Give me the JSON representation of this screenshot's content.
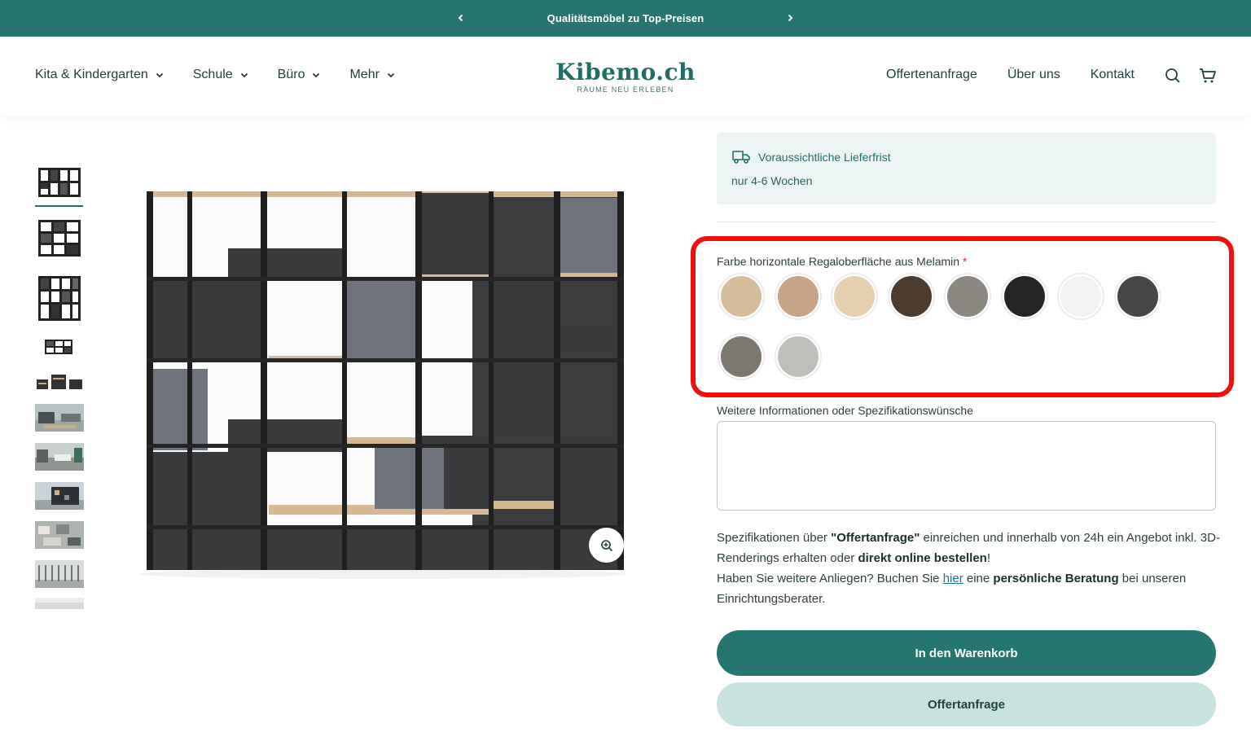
{
  "announcement": {
    "text": "Qualitätsmöbel zu Top-Preisen",
    "prev_icon": "chevron-left-icon",
    "next_icon": "chevron-right-icon"
  },
  "nav": {
    "left": [
      {
        "label": "Kita & Kindergarten"
      },
      {
        "label": "Schule"
      },
      {
        "label": "Büro"
      },
      {
        "label": "Mehr"
      }
    ],
    "right": [
      {
        "label": "Offertenanfrage"
      },
      {
        "label": "Über uns"
      },
      {
        "label": "Kontakt"
      }
    ]
  },
  "logo": {
    "word": "Kibemo.ch",
    "tagline": "RÄUME NEU ERLEBEN"
  },
  "delivery": {
    "title": "Voraussichtliche Lieferfrist",
    "subtitle": "nur 4-6 Wochen"
  },
  "swatches": {
    "label": "Farbe horizontale Regaloberfläche aus Melamin",
    "required_mark": "*",
    "colors": [
      "#d6bd9a",
      "#c8a487",
      "#e6cfae",
      "#4c3a2c",
      "#8b8881",
      "#252525",
      "#f2f2f2",
      "#474747",
      "#7c776f",
      "#c0bebb"
    ]
  },
  "more_info": {
    "label": "Weitere Informationen oder Spezifikationswünsche",
    "placeholder": ""
  },
  "info_text": {
    "p1_a": "Spezifikationen über ",
    "p1_b": "\"Offertanfrage\"",
    "p1_c": " einreichen und innerhalb von 24h ein Angebot inkl. 3D-Renderings erhalten oder ",
    "p1_d": "direkt online bestellen",
    "p1_e": "!",
    "p2_a": "Haben Sie weitere Anliegen? Buchen Sie ",
    "p2_link": "hier",
    "p2_b": " eine ",
    "p2_c": "persönliche Beratung",
    "p2_d": " bei unseren Einrichtungsberater."
  },
  "buttons": {
    "cart": "In den Warenkorb",
    "offer": "Offertanfrage"
  },
  "colors": {
    "primary": "#257670",
    "secondary": "#c8e3df",
    "highlight": "#ee0f0f"
  }
}
